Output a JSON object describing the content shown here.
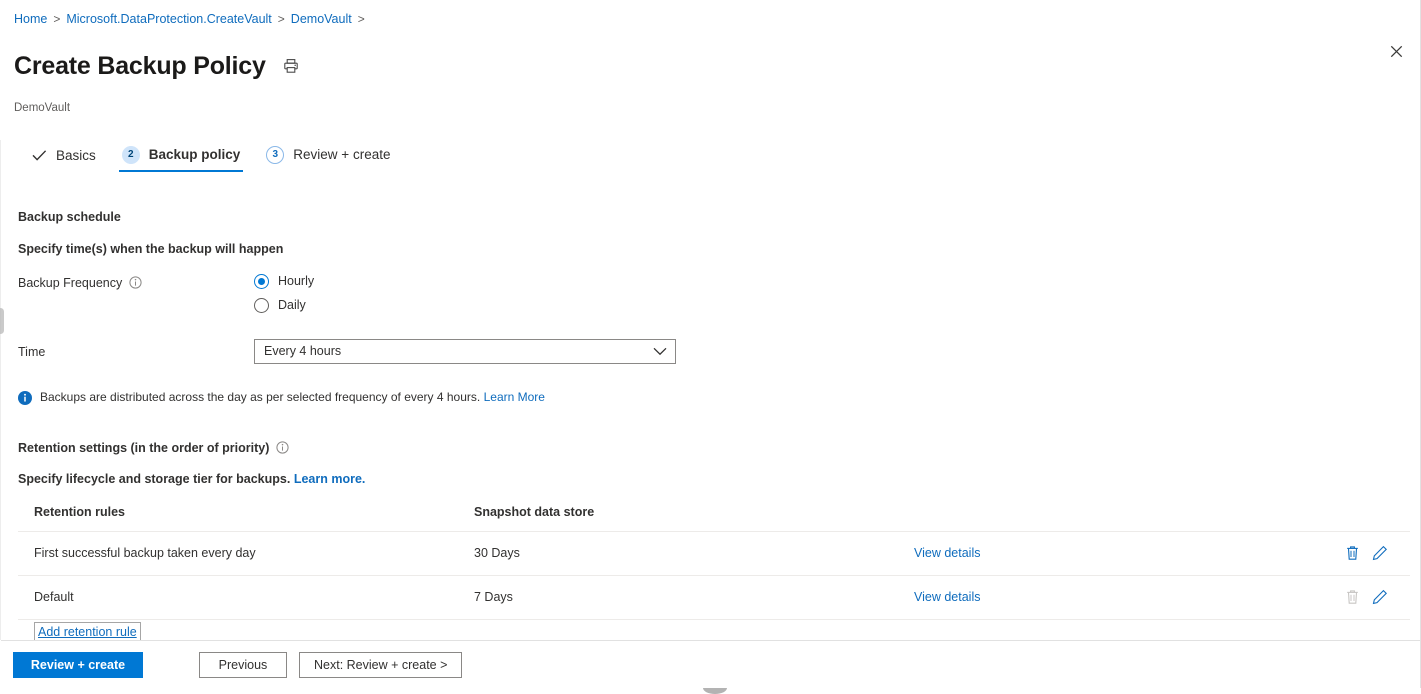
{
  "breadcrumb": {
    "items": [
      {
        "label": "Home"
      },
      {
        "label": "Microsoft.DataProtection.CreateVault"
      },
      {
        "label": "DemoVault"
      }
    ],
    "separator": ">"
  },
  "header": {
    "title": "Create Backup Policy",
    "subtitle": "DemoVault",
    "print_icon": "printer-icon",
    "close_icon": "close-icon",
    "close_glyph": "✕"
  },
  "wizard": {
    "tabs": [
      {
        "id": "basics",
        "label": "Basics",
        "marker": "check",
        "marker_text": "✓",
        "active": false
      },
      {
        "id": "backup-policy",
        "label": "Backup policy",
        "marker": "number",
        "marker_text": "2",
        "active": true
      },
      {
        "id": "review-create",
        "label": "Review + create",
        "marker": "number",
        "marker_text": "3",
        "active": false
      }
    ]
  },
  "form": {
    "schedule_title": "Backup schedule",
    "schedule_subtitle": "Specify time(s) when the backup will happen",
    "frequency": {
      "label": "Backup Frequency",
      "info_icon": "info-icon",
      "options": [
        {
          "label": "Hourly",
          "checked": true
        },
        {
          "label": "Daily",
          "checked": false
        }
      ]
    },
    "time": {
      "label": "Time",
      "value": "Every 4 hours",
      "chevron_icon": "chevron-down-icon"
    },
    "info_message": {
      "icon": "info-filled-icon",
      "text": "Backups are distributed across the day as per selected frequency of every 4 hours.",
      "link_label": "Learn More"
    },
    "retention": {
      "title": "Retention settings (in the order of priority)",
      "info_icon": "info-icon",
      "subtitle_text": "Specify lifecycle and storage tier for backups.",
      "subtitle_link": "Learn more.",
      "add_rule_label": "Add retention rule"
    }
  },
  "table": {
    "columns": [
      "Retention rules",
      "Snapshot data store",
      "",
      ""
    ],
    "rows": [
      {
        "rule": "First successful backup taken every day",
        "store": "30 Days",
        "details_label": "View details",
        "delete_enabled": true,
        "delete_icon": "trash-icon",
        "edit_icon": "pencil-icon"
      },
      {
        "rule": "Default",
        "store": "7 Days",
        "details_label": "View details",
        "delete_enabled": false,
        "delete_icon": "trash-icon",
        "edit_icon": "pencil-icon"
      }
    ]
  },
  "footer": {
    "review_create": "Review + create",
    "previous": "Previous",
    "next": "Next: Review + create >"
  },
  "colors": {
    "accent": "#0078d4",
    "link": "#0f6cbd",
    "text": "#323130",
    "muted": "#605e5c",
    "border": "#e1e1e1",
    "disabled_icon": "#c8c6c4"
  }
}
